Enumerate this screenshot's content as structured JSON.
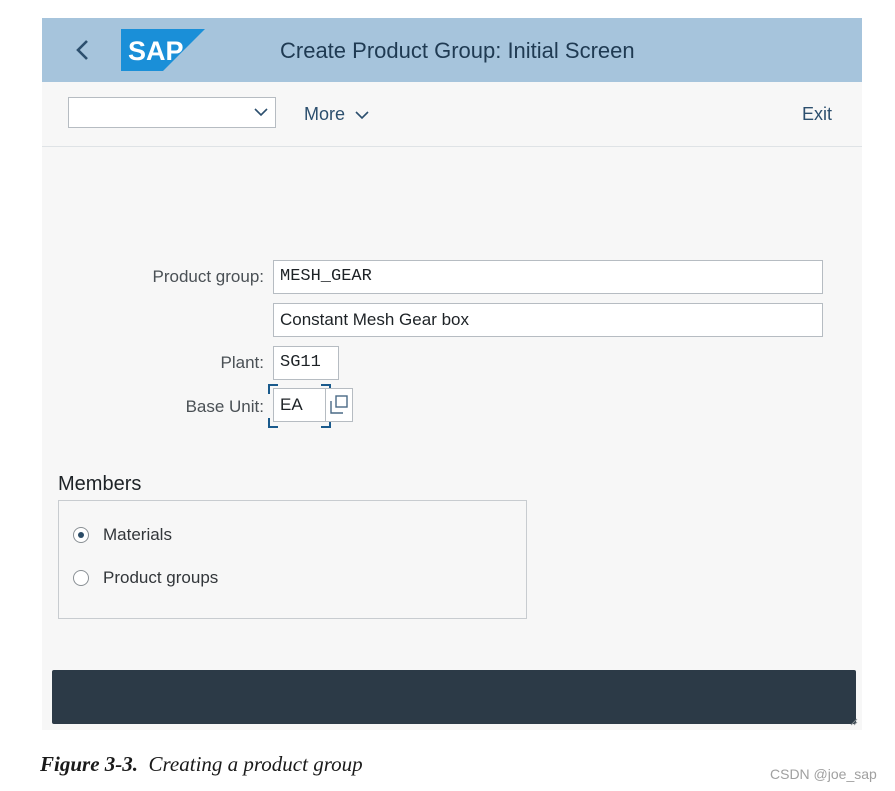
{
  "header": {
    "title": "Create Product Group: Initial Screen",
    "logo_text": "SAP",
    "back_icon": "chevron-left-icon",
    "colors": {
      "bar": "#a6c4dc",
      "logo": "#1a8fd8"
    }
  },
  "toolbar": {
    "dropdown_value": "",
    "more_label": "More",
    "exit_label": "Exit"
  },
  "form": {
    "product_group_label": "Product group:",
    "product_group_value": "MESH_GEAR",
    "description_value": "Constant Mesh Gear box",
    "plant_label": "Plant:",
    "plant_value": "SG11",
    "base_unit_label": "Base Unit:",
    "base_unit_value": "EA",
    "value_help_icon": "value-help-icon"
  },
  "members": {
    "title": "Members",
    "options": [
      {
        "label": "Materials",
        "selected": true
      },
      {
        "label": "Product groups",
        "selected": false
      }
    ]
  },
  "footer": {
    "color": "#2c3a47"
  },
  "caption": {
    "figure": "Figure 3-3.",
    "text": "Creating a product group"
  },
  "watermark": "CSDN @joe_sap"
}
